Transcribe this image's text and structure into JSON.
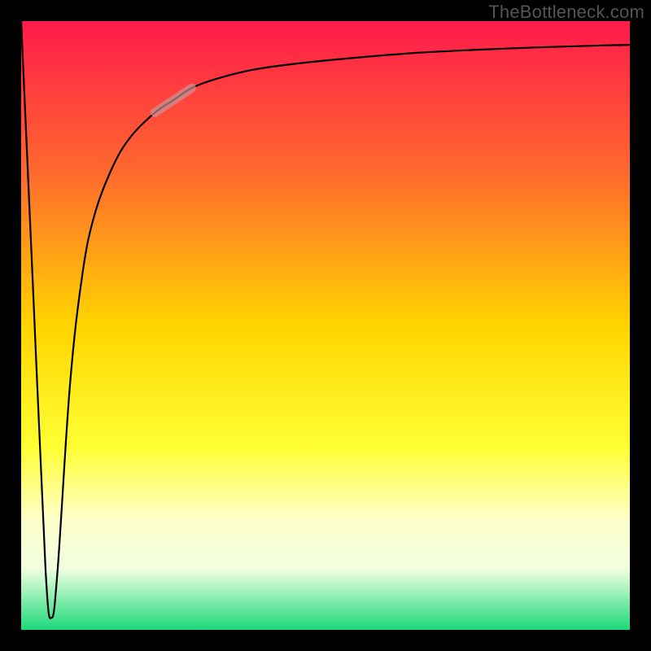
{
  "watermark": "TheBottleneck.com",
  "chart_data": {
    "type": "line",
    "title": "",
    "xlabel": "",
    "ylabel": "",
    "xlim": [
      0,
      100
    ],
    "ylim": [
      0,
      100
    ],
    "grid": false,
    "background_gradient_stops": [
      {
        "offset": 0.0,
        "color": "#ff1a4b"
      },
      {
        "offset": 0.25,
        "color": "#ff6a2e"
      },
      {
        "offset": 0.5,
        "color": "#ffd400"
      },
      {
        "offset": 0.7,
        "color": "#ffff33"
      },
      {
        "offset": 0.82,
        "color": "#ffffcc"
      },
      {
        "offset": 0.9,
        "color": "#f0ffe0"
      },
      {
        "offset": 1.0,
        "color": "#1cd97a"
      }
    ],
    "series": [
      {
        "name": "bottleneck-curve",
        "color": "#000000",
        "width": 2.2,
        "x": [
          0,
          2,
          4,
          5,
          6,
          8,
          10,
          12,
          15,
          18,
          22,
          25,
          28,
          32,
          38,
          45,
          55,
          65,
          75,
          85,
          95,
          100
        ],
        "y": [
          100,
          55,
          10,
          2,
          10,
          40,
          58,
          68,
          76,
          81,
          85,
          87,
          89,
          90.5,
          92,
          93,
          94,
          94.8,
          95.3,
          95.7,
          96,
          96.1
        ]
      },
      {
        "name": "highlight-segment",
        "color": "#c79aa0",
        "width": 11,
        "opacity": 0.65,
        "x": [
          22,
          25,
          28
        ],
        "y": [
          85,
          87,
          89
        ]
      }
    ],
    "annotations": []
  }
}
